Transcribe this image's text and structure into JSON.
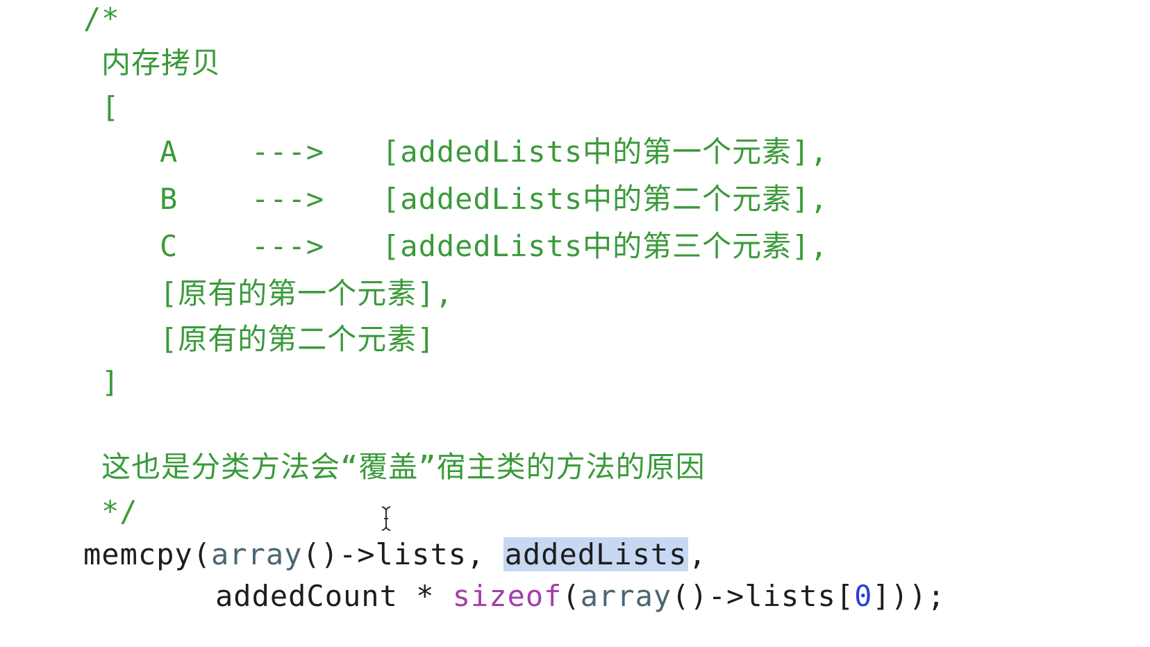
{
  "comment": {
    "open": "/*",
    "title": "内存拷贝",
    "bracket_open": "[",
    "rows": [
      {
        "label": "A",
        "arrow": "--->",
        "value": "[addedLists中的第一个元素],"
      },
      {
        "label": "B",
        "arrow": "--->",
        "value": "[addedLists中的第二个元素],"
      },
      {
        "label": "C",
        "arrow": "--->",
        "value": "[addedLists中的第三个元素],"
      }
    ],
    "original_1": "[原有的第一个元素],",
    "original_2": "[原有的第二个元素]",
    "bracket_close": "]",
    "reason": "这也是分类方法会“覆盖”宿主类的方法的原因",
    "close": "*/"
  },
  "code": {
    "line1": {
      "fn": "memcpy(",
      "array": "array",
      "rest": "()->lists, ",
      "selected": "addedLists",
      "comma": ","
    },
    "line2": {
      "count": "addedCount * ",
      "sizeof": "sizeof",
      "paren": "(",
      "array": "array",
      "lists": "()->lists[",
      "zero": "0",
      "end": "]));"
    }
  },
  "icons": {
    "cursor": "text-cursor-icon"
  },
  "colors": {
    "comment": "#3a9a3a",
    "keyword": "#a43dab",
    "identifier": "#4a6572",
    "number": "#2b3fd6",
    "selection": "#c6d8f2"
  }
}
